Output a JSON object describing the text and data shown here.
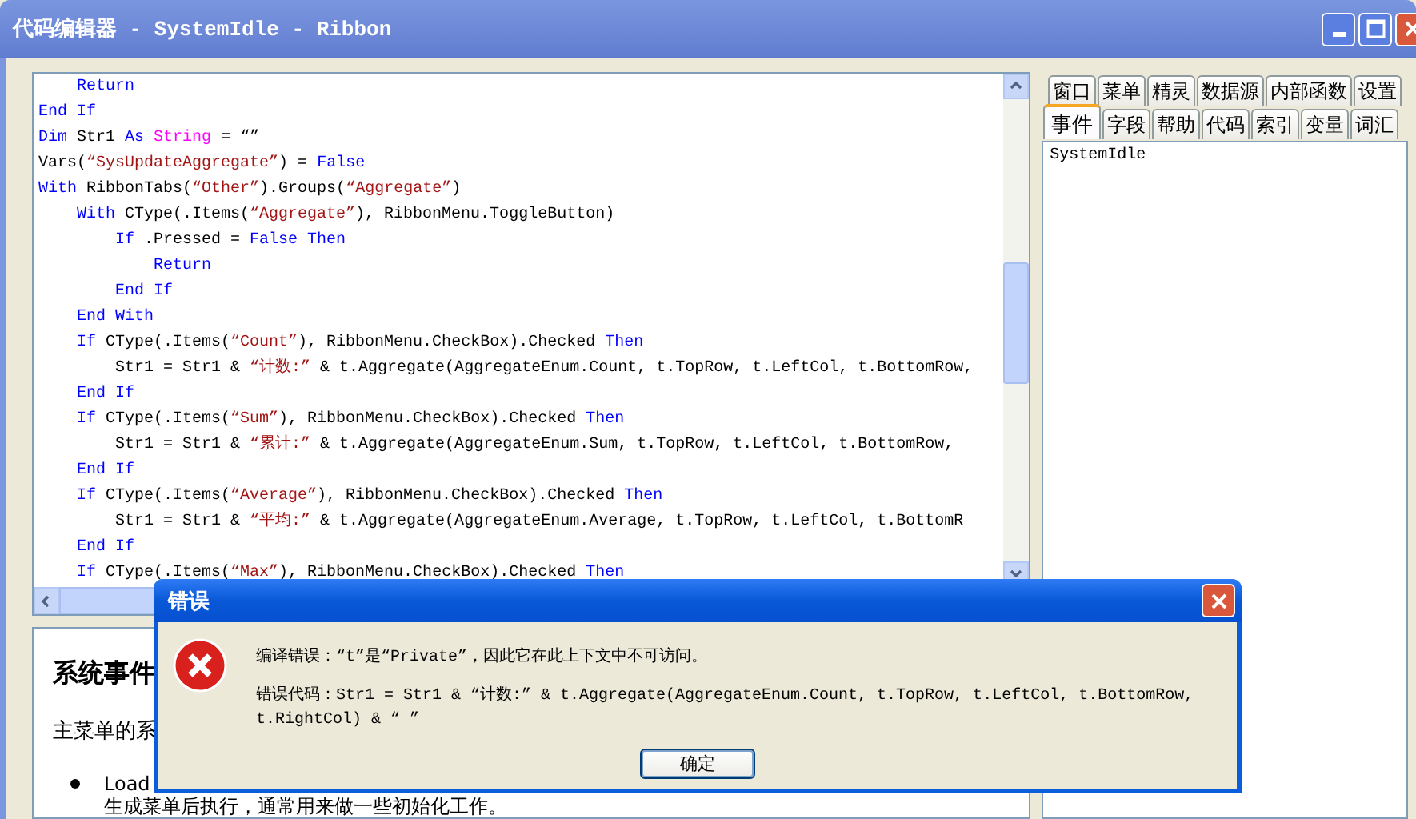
{
  "window": {
    "title": "代码编辑器 - SystemIdle - Ribbon"
  },
  "code_lines": [
    [
      {
        "kind": "kw",
        "text": "    Return"
      }
    ],
    [
      {
        "kind": "kw",
        "text": "End If"
      }
    ],
    [
      {
        "kind": "kw",
        "text": "Dim"
      },
      {
        "kind": "plain",
        "text": " Str1 "
      },
      {
        "kind": "kw",
        "text": "As "
      },
      {
        "kind": "type",
        "text": "String"
      },
      {
        "kind": "plain",
        "text": " = “”"
      }
    ],
    [
      {
        "kind": "plain",
        "text": "Vars("
      },
      {
        "kind": "str",
        "text": "“SysUpdateAggregate”"
      },
      {
        "kind": "plain",
        "text": ") = "
      },
      {
        "kind": "kw",
        "text": "False"
      }
    ],
    [
      {
        "kind": "kw",
        "text": "With"
      },
      {
        "kind": "plain",
        "text": " RibbonTabs("
      },
      {
        "kind": "str",
        "text": "“Other”"
      },
      {
        "kind": "plain",
        "text": ").Groups("
      },
      {
        "kind": "str",
        "text": "“Aggregate”"
      },
      {
        "kind": "plain",
        "text": ")"
      }
    ],
    [
      {
        "kind": "kw",
        "text": "    With"
      },
      {
        "kind": "plain",
        "text": " CType(.Items("
      },
      {
        "kind": "str",
        "text": "“Aggregate”"
      },
      {
        "kind": "plain",
        "text": "), RibbonMenu.ToggleButton)"
      }
    ],
    [
      {
        "kind": "kw",
        "text": "        If"
      },
      {
        "kind": "plain",
        "text": " .Pressed = "
      },
      {
        "kind": "kw",
        "text": "False Then"
      }
    ],
    [
      {
        "kind": "kw",
        "text": "            Return"
      }
    ],
    [
      {
        "kind": "kw",
        "text": "        End If"
      }
    ],
    [
      {
        "kind": "kw",
        "text": "    End With"
      }
    ],
    [
      {
        "kind": "kw",
        "text": "    If"
      },
      {
        "kind": "plain",
        "text": " CType(.Items("
      },
      {
        "kind": "str",
        "text": "“Count”"
      },
      {
        "kind": "plain",
        "text": "), RibbonMenu.CheckBox).Checked "
      },
      {
        "kind": "kw",
        "text": "Then"
      }
    ],
    [
      {
        "kind": "plain",
        "text": "        Str1 = Str1 & "
      },
      {
        "kind": "str",
        "text": "“计数:”"
      },
      {
        "kind": "plain",
        "text": " & t.Aggregate(AggregateEnum.Count, t.TopRow, t.LeftCol, t.BottomRow,"
      }
    ],
    [
      {
        "kind": "kw",
        "text": "    End If"
      }
    ],
    [
      {
        "kind": "kw",
        "text": "    If"
      },
      {
        "kind": "plain",
        "text": " CType(.Items("
      },
      {
        "kind": "str",
        "text": "“Sum”"
      },
      {
        "kind": "plain",
        "text": "), RibbonMenu.CheckBox).Checked "
      },
      {
        "kind": "kw",
        "text": "Then"
      }
    ],
    [
      {
        "kind": "plain",
        "text": "        Str1 = Str1 & "
      },
      {
        "kind": "str",
        "text": "“累计:”"
      },
      {
        "kind": "plain",
        "text": " & t.Aggregate(AggregateEnum.Sum, t.TopRow, t.LeftCol, t.BottomRow,"
      }
    ],
    [
      {
        "kind": "kw",
        "text": "    End If"
      }
    ],
    [
      {
        "kind": "kw",
        "text": "    If"
      },
      {
        "kind": "plain",
        "text": " CType(.Items("
      },
      {
        "kind": "str",
        "text": "“Average”"
      },
      {
        "kind": "plain",
        "text": "), RibbonMenu.CheckBox).Checked "
      },
      {
        "kind": "kw",
        "text": "Then"
      }
    ],
    [
      {
        "kind": "plain",
        "text": "        Str1 = Str1 & "
      },
      {
        "kind": "str",
        "text": "“平均:”"
      },
      {
        "kind": "plain",
        "text": " & t.Aggregate(AggregateEnum.Average, t.TopRow, t.LeftCol, t.BottomR"
      }
    ],
    [
      {
        "kind": "kw",
        "text": "    End If"
      }
    ],
    [
      {
        "kind": "kw",
        "text": "    If"
      },
      {
        "kind": "plain",
        "text": " CType(.Items("
      },
      {
        "kind": "str",
        "text": "“Max”"
      },
      {
        "kind": "plain",
        "text": "), RibbonMenu.CheckBox).Checked "
      },
      {
        "kind": "kw",
        "text": "Then"
      }
    ]
  ],
  "help": {
    "heading": "系统事件",
    "intro": "主菜单的系",
    "bullet": "Load",
    "bullet_text": "生成菜单后执行，通常用来做一些初始化工作。"
  },
  "tab_rows": [
    [
      {
        "label": "窗口",
        "selected": false
      },
      {
        "label": "菜单",
        "selected": false
      },
      {
        "label": "精灵",
        "selected": false
      },
      {
        "label": "数据源",
        "selected": false
      },
      {
        "label": "内部函数",
        "selected": false
      },
      {
        "label": "设置",
        "selected": false
      }
    ],
    [
      {
        "label": "事件",
        "selected": true
      },
      {
        "label": "字段",
        "selected": false
      },
      {
        "label": "帮助",
        "selected": false
      },
      {
        "label": "代码",
        "selected": false
      },
      {
        "label": "索引",
        "selected": false
      },
      {
        "label": "变量",
        "selected": false
      },
      {
        "label": "词汇",
        "selected": false
      }
    ]
  ],
  "list_items": [
    "SystemIdle"
  ],
  "dialog": {
    "title": "错误",
    "message": "编译错误：“t”是“Private”，因此它在此上下文中不可访问。",
    "code": "错误代码：Str1 = Str1 & “计数:” & t.Aggregate(AggregateEnum.Count, t.TopRow, t.LeftCol, t.BottomRow, t.RightCol) & “ ”",
    "button": "确定"
  }
}
